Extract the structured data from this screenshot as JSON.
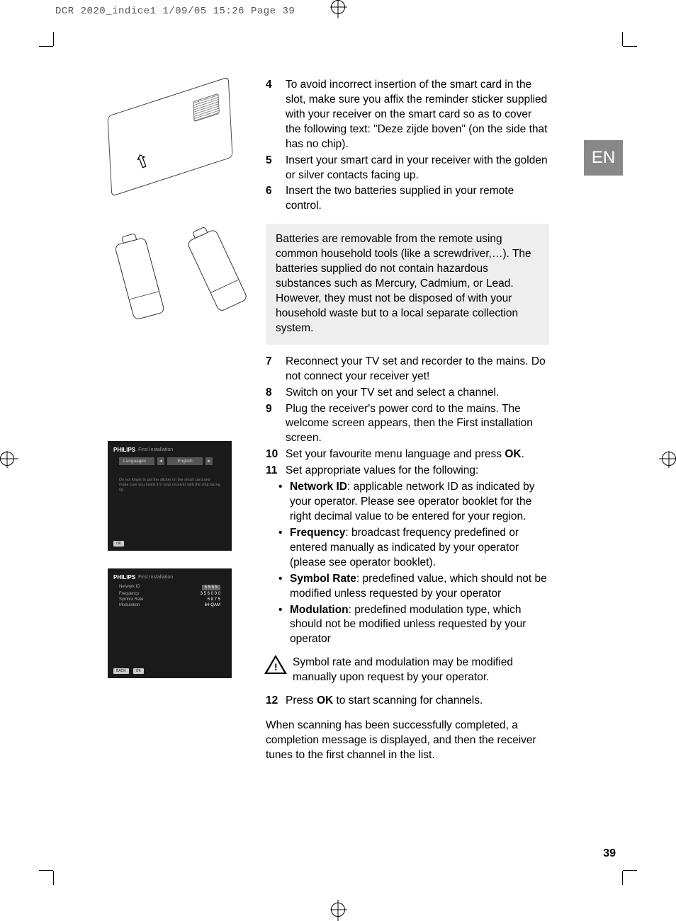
{
  "print_header": "DCR 2020_indice1  1/09/05  15:26  Page 39",
  "lang_tab": "EN",
  "page_number": "39",
  "steps_a": [
    {
      "num": "4",
      "text": "To avoid incorrect insertion of the smart card in the slot, make sure you affix the reminder sticker supplied with your receiver on the smart card so as to cover the following text: \"Deze zijde boven\" (on the side that has no chip)."
    },
    {
      "num": "5",
      "text": "Insert your smart card in your receiver with the golden or silver contacts facing up."
    },
    {
      "num": "6",
      "text": "Insert the two batteries supplied in your remote control."
    }
  ],
  "note_box": "Batteries are removable from the remote using common household tools (like a screwdriver,…). The batteries supplied do not contain hazardous substances such as Mercury, Cadmium, or Lead. However, they must not be disposed of with your household waste but to a local separate collection system.",
  "steps_b": [
    {
      "num": "7",
      "text": "Reconnect your TV set and recorder to the mains. Do not connect your receiver yet!"
    },
    {
      "num": "8",
      "text": "Switch on your TV set and select a channel."
    },
    {
      "num": "9",
      "text": "Plug the receiver's power cord to the mains. The welcome screen appears, then the First installation screen."
    },
    {
      "num": "10",
      "text_pre": "Set your favourite menu language and press ",
      "bold": "OK",
      "text_post": "."
    },
    {
      "num": "11",
      "text": "Set appropriate values for the following:"
    }
  ],
  "sub_items": [
    {
      "bold": "Network ID",
      "text": ": applicable network ID as indicated by your operator. Please see operator booklet for the right decimal value to be entered for your region."
    },
    {
      "bold": "Frequency",
      "text": ": broadcast frequency predefined or entered manually as indicated by your operator (please see operator booklet)."
    },
    {
      "bold": "Symbol Rate",
      "text": ": predefined value, which should not be modified unless requested by your operator"
    },
    {
      "bold": "Modulation",
      "text": ": predefined modulation type, which should not be modified unless requested by your operator"
    }
  ],
  "warning_text": "Symbol rate and modulation may be modified manually upon request by your operator.",
  "step12": {
    "num": "12",
    "text_pre": "Press ",
    "bold": "OK",
    "text_post": " to start scanning for channels."
  },
  "closing": "When scanning has been successfully completed, a completion message is displayed, and then the receiver tunes to the first channel in the list.",
  "ui1": {
    "brand": "PHILIPS",
    "title": "First Installation",
    "row_label": "Languages",
    "row_value": "English",
    "hint": "Do not forget to put the sticker on the smart card and make sure you insert it in your receiver with the chip facing up.",
    "footer": "OK"
  },
  "ui2": {
    "brand": "PHILIPS",
    "title": "First Installation",
    "rows": [
      {
        "label": "Network ID",
        "value": "5 5 5 5",
        "highlighted": true
      },
      {
        "label": "Frequency",
        "value": "3 5 6 0 0 0"
      },
      {
        "label": "Symbol Rate",
        "value": "6 8 7 5"
      },
      {
        "label": "Modulation",
        "value": "64-QAM"
      }
    ],
    "footer1": "BACK",
    "footer2": "OK"
  }
}
